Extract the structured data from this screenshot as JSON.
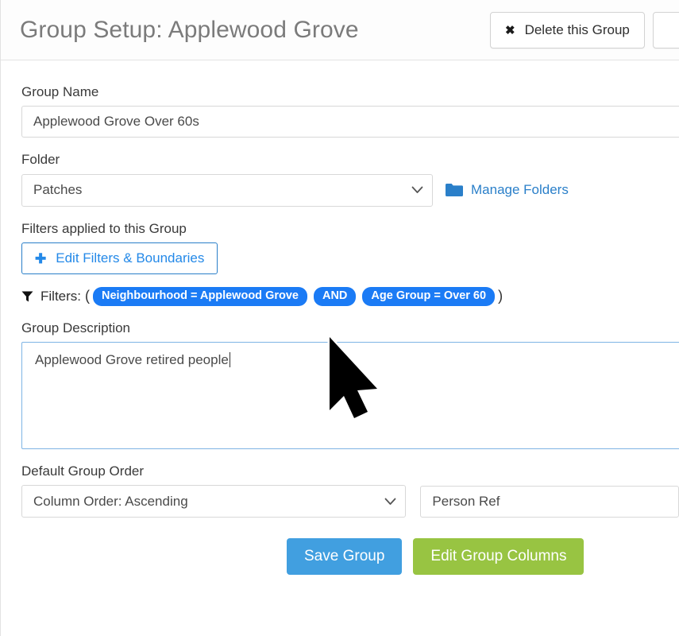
{
  "header": {
    "title_prefix": "Group Setup:",
    "title_group": "Applewood Grove",
    "delete_button": "Delete this Group",
    "delete_icon": "close-x-icon"
  },
  "form": {
    "group_name": {
      "label": "Group Name",
      "value": "Applewood Grove Over 60s",
      "placeholder": "Group Name"
    },
    "folder": {
      "label": "Folder",
      "selected": "Patches",
      "options": [
        "Patches"
      ],
      "manage_link": "Manage Folders",
      "folder_icon": "folder-icon",
      "chevron_icon": "chevron-down-icon"
    },
    "filters": {
      "label": "Filters applied to this Group",
      "edit_button": "Edit Filters & Boundaries",
      "edit_button_icon": "plus-icon",
      "funnel_icon": "funnel-icon",
      "prefix": "Filters:",
      "open_paren": "(",
      "close_paren": ")",
      "badges": [
        "Neighbourhood = Applewood Grove",
        "AND",
        "Age Group = Over 60"
      ]
    },
    "description": {
      "label": "Group Description",
      "value": "Applewood Grove retired people",
      "placeholder": "Group Description"
    },
    "order": {
      "label": "Default Group Order",
      "selected": "Column Order: Ascending",
      "options": [
        "Column Order: Ascending"
      ],
      "chevron_icon": "chevron-down-icon",
      "column_value": "Person Ref",
      "column_placeholder": "Person Ref"
    }
  },
  "actions": {
    "save": "Save Group",
    "edit_columns": "Edit Group Columns"
  },
  "colors": {
    "badge_blue": "#1b7bf5",
    "link_blue": "#2a7fc9",
    "save_blue": "#419fe0",
    "green": "#98c442",
    "title_gray": "#7b7b7b",
    "focus_border": "#7fb4e4"
  }
}
